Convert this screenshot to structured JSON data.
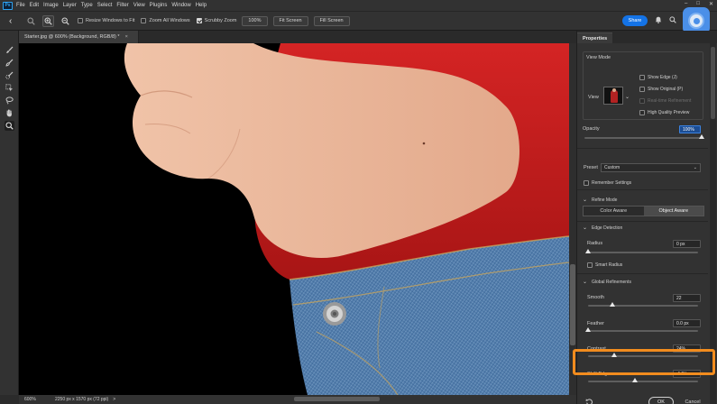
{
  "app": {
    "logo": "Ps",
    "menu": [
      "File",
      "Edit",
      "Image",
      "Layer",
      "Type",
      "Select",
      "Filter",
      "View",
      "Plugins",
      "Window",
      "Help"
    ],
    "window_controls": [
      "–",
      "□",
      "✕"
    ]
  },
  "options_bar": {
    "resize_windows": "Resize Windows to Fit",
    "zoom_all": "Zoom All Windows",
    "scrubby_zoom": "Scrubby Zoom",
    "zoom_value": "100%",
    "fit_screen": "Fit Screen",
    "fill_screen": "Fill Screen",
    "share": "Share"
  },
  "document": {
    "tab_title": "Starter.jpg @ 600% (Background, RGB/8) *",
    "close": "×"
  },
  "status_bar": {
    "zoom": "600%",
    "dimensions": "2250 px x 1570 px (72 ppi)",
    "arrow": ">"
  },
  "properties": {
    "tab": "Properties",
    "view_mode": {
      "title": "View Mode",
      "view_label": "View",
      "show_edge": "Show Edge (J)",
      "show_original": "Show Original (P)",
      "real_time": "Real-time Refinement",
      "hq_preview": "High Quality Preview"
    },
    "opacity": {
      "label": "Opacity",
      "value": "100%",
      "level": 1.0
    },
    "preset": {
      "label": "Preset",
      "value": "Custom"
    },
    "remember_settings": "Remember Settings",
    "refine_mode": {
      "title": "Refine Mode",
      "color_aware": "Color Aware",
      "object_aware": "Object Aware"
    },
    "edge_detection": {
      "title": "Edge Detection",
      "radius_label": "Radius",
      "radius_value": "0 px",
      "radius_level": 0.0,
      "smart_radius": "Smart Radius"
    },
    "global_refinements": {
      "title": "Global Refinements",
      "smooth_label": "Smooth",
      "smooth_value": "22",
      "smooth_level": 0.22,
      "feather_label": "Feather",
      "feather_value": "0.0 px",
      "feather_level": 0.0,
      "contrast_label": "Contrast",
      "contrast_value": "24%",
      "contrast_level": 0.24,
      "shift_edge_label": "Shift Edge",
      "shift_edge_value": "-14%",
      "shift_edge_level": 0.43
    },
    "ok": "OK",
    "cancel": "Cancel"
  },
  "colors": {
    "accent": "#1473e6",
    "highlight": "#f28c1e",
    "shirt": "#c81e1e",
    "skin": "#e8b59a",
    "denim": "#4a78a8"
  }
}
